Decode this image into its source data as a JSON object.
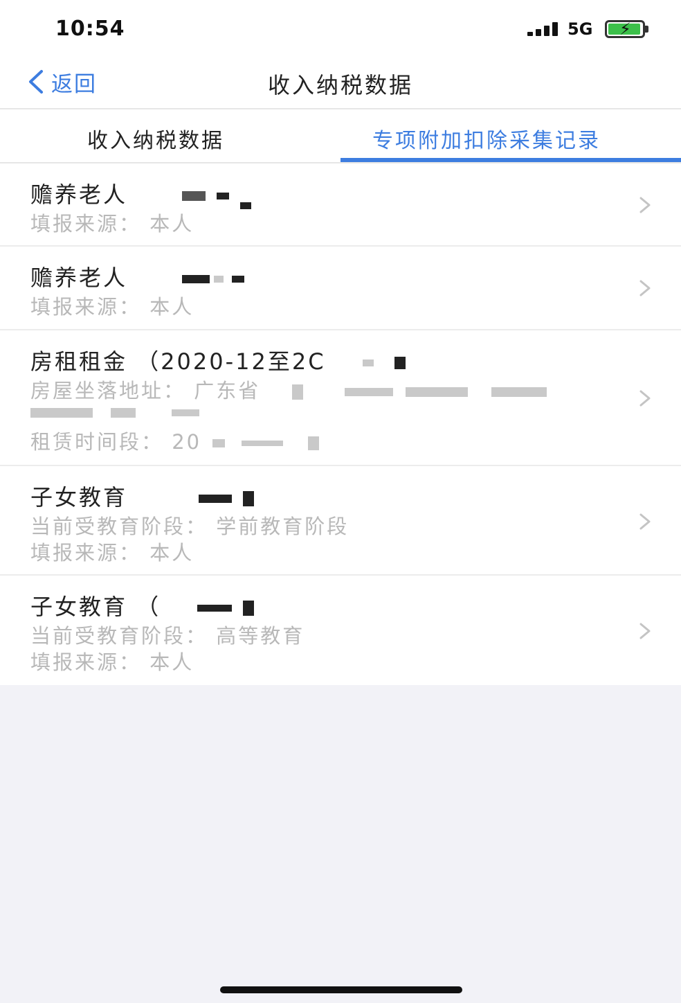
{
  "status_bar": {
    "time": "10:54",
    "network": "5G"
  },
  "nav": {
    "back_label": "返回",
    "title": "收入纳税数据"
  },
  "tabs": [
    {
      "label": "收入纳税数据",
      "active": false
    },
    {
      "label": "专项附加扣除采集记录",
      "active": true
    }
  ],
  "items": [
    {
      "title": "赡养老人",
      "lines": [
        "填报来源：  本人"
      ]
    },
    {
      "title": "赡养老人",
      "lines": [
        "填报来源：  本人"
      ]
    },
    {
      "title": "房租租金 （2020-12至2C",
      "lines": [
        "房屋坐落地址：  广东省",
        "",
        "租赁时间段：  20"
      ]
    },
    {
      "title": "子女教育",
      "lines": [
        "当前受教育阶段：  学前教育阶段",
        "填报来源：  本人"
      ]
    },
    {
      "title": "子女教育 （",
      "lines": [
        "当前受教育阶段：  高等教育",
        "填报来源：  本人"
      ]
    }
  ],
  "colors": {
    "accent": "#3d7de0",
    "battery": "#3cc04a",
    "background": "#f2f2f7"
  }
}
